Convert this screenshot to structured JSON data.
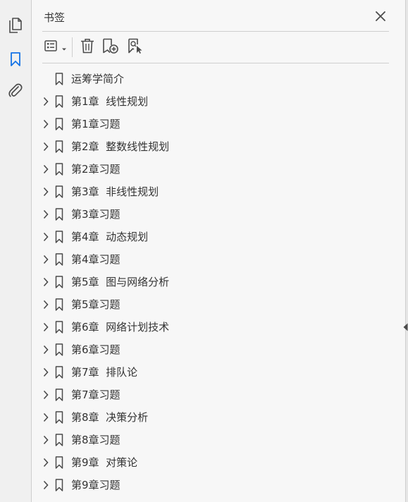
{
  "rail": {
    "items": [
      {
        "name": "pages-icon"
      },
      {
        "name": "bookmarks-icon"
      },
      {
        "name": "attachments-icon"
      }
    ]
  },
  "panel": {
    "title": "书签",
    "toolbar": {
      "options_icon": "list-options-icon",
      "delete_icon": "trash-icon",
      "new_bookmark_icon": "new-bookmark-icon",
      "expand_icon": "bookmark-search-icon"
    }
  },
  "bookmarks": [
    {
      "label": "运筹学简介",
      "expandable": false
    },
    {
      "label": "第1章  线性规划",
      "expandable": true
    },
    {
      "label": "第1章习题",
      "expandable": true
    },
    {
      "label": "第2章  整数线性规划",
      "expandable": true
    },
    {
      "label": "第2章习题",
      "expandable": true
    },
    {
      "label": "第3章  非线性规划",
      "expandable": true
    },
    {
      "label": "第3章习题",
      "expandable": true
    },
    {
      "label": "第4章  动态规划",
      "expandable": true
    },
    {
      "label": "第4章习题",
      "expandable": true
    },
    {
      "label": "第5章  图与网络分析",
      "expandable": true
    },
    {
      "label": "第5章习题",
      "expandable": true
    },
    {
      "label": "第6章  网络计划技术",
      "expandable": true
    },
    {
      "label": "第6章习题",
      "expandable": true
    },
    {
      "label": "第7章  排队论",
      "expandable": true
    },
    {
      "label": "第7章习题",
      "expandable": true
    },
    {
      "label": "第8章  决策分析",
      "expandable": true
    },
    {
      "label": "第8章习题",
      "expandable": true
    },
    {
      "label": "第9章  对策论",
      "expandable": true
    },
    {
      "label": "第9章习题",
      "expandable": true
    }
  ],
  "colors": {
    "accent": "#1473e6",
    "text": "#333333",
    "icon": "#4b4b4b"
  }
}
